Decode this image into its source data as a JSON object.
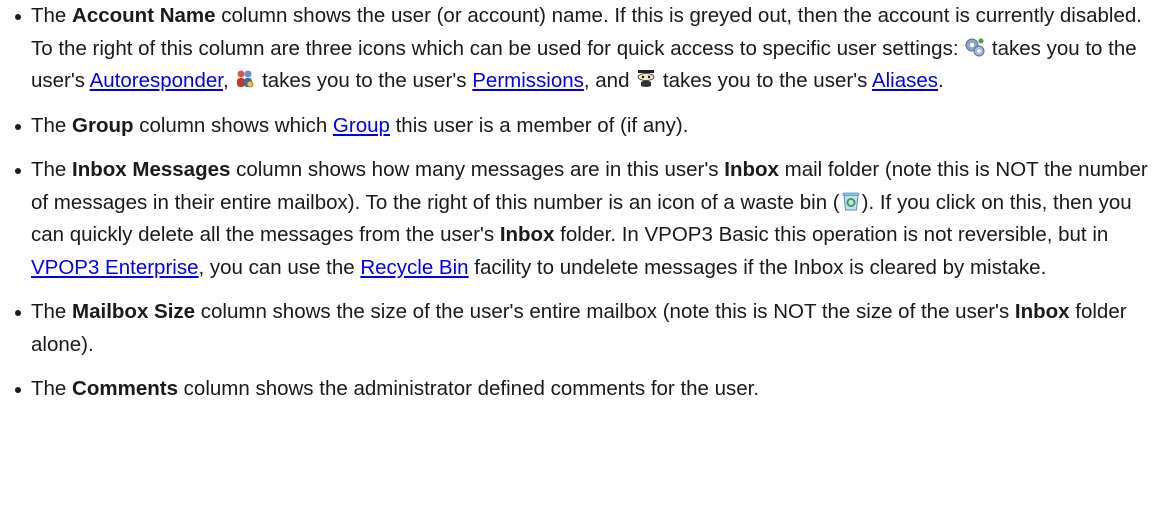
{
  "items": [
    {
      "parts": {
        "t1": "The ",
        "b1": "Account Name",
        "t2": " column shows the user (or account) name. If this is greyed out, then the account is currently disabled. To the right of this column are three icons which can be used for quick access to specific user settings: ",
        "icon1": "gears-icon",
        "t3": " takes you to the user's ",
        "link1": "Autoresponder",
        "t4": ", ",
        "icon2": "permissions-icon",
        "t5": " takes you to the user's ",
        "link2": "Permissions",
        "t6": ", and ",
        "icon3": "aliases-mask-icon",
        "t7": " takes you to the user's ",
        "link3": "Aliases",
        "t8": "."
      }
    },
    {
      "parts": {
        "t1": "The ",
        "b1": "Group",
        "t2": " column shows which ",
        "link1": "Group",
        "t3": " this user is a member of (if any)."
      }
    },
    {
      "parts": {
        "t1": "The ",
        "b1": "Inbox Messages",
        "t2": " column shows how many messages are in this user's ",
        "b2": "Inbox",
        "t3": " mail folder (note this is NOT the number of messages in their entire mailbox). To the right of this number is an icon of a waste bin (",
        "icon1": "recycle-bin-icon",
        "t4": "). If you click on this, then you can quickly delete all the messages from the user's ",
        "b3": "Inbox",
        "t5": " folder. In VPOP3 Basic this operation is not reversible, but in ",
        "link1": "VPOP3 Enterprise",
        "t6": ", you can use the ",
        "link2": "Recycle Bin",
        "t7": " facility to undelete messages if the Inbox is cleared by mistake."
      }
    },
    {
      "parts": {
        "t1": "The ",
        "b1": "Mailbox Size",
        "t2": " column shows the size of the user's entire mailbox (note this is NOT the size of the user's ",
        "b2": "Inbox",
        "t3": " folder alone)."
      }
    },
    {
      "parts": {
        "t1": "The ",
        "b1": "Comments",
        "t2": " column shows the administrator defined comments for the user."
      }
    }
  ],
  "colors": {
    "text": "#1a1a1a",
    "link": "#0000ee",
    "background": "#ffffff"
  }
}
